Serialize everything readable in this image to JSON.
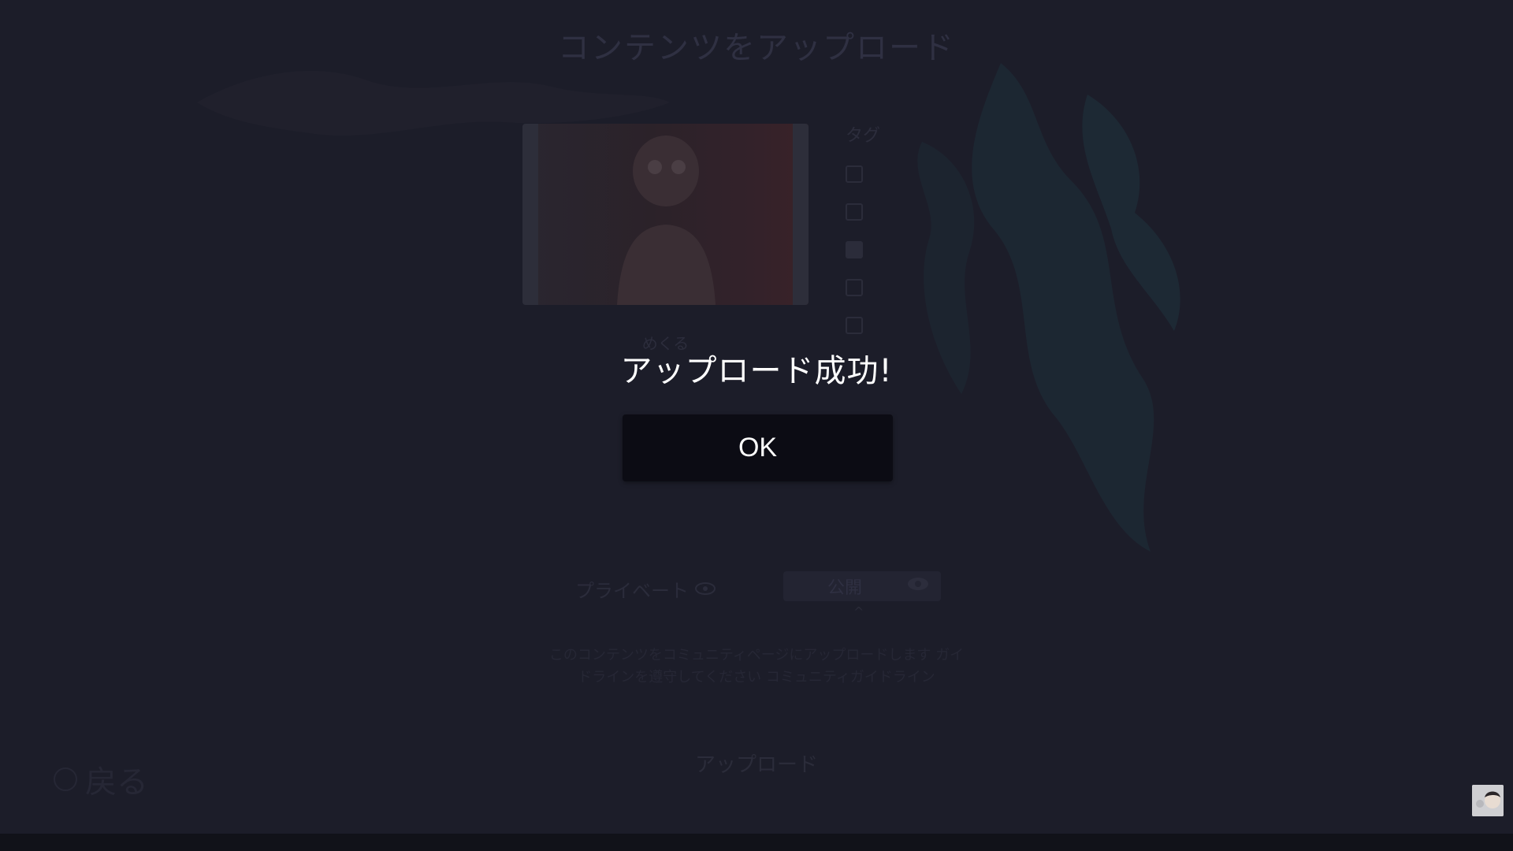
{
  "background": {
    "title": "コンテンツをアップロード",
    "thumbnail_caption": "めくる",
    "tags": {
      "title": "タグ"
    },
    "small_label": "",
    "privacy": {
      "label": "プライベート",
      "selected": "公開"
    },
    "notice": "このコンテンツをコミュニティページにアップロードします ガイドラインを遵守してください コミュニティガイドライン",
    "upload_button": "アップロード",
    "back_label": "戻る"
  },
  "modal": {
    "message": "アップロード成功!",
    "ok_label": "OK"
  },
  "colors": {
    "backdrop": "#1c1d29",
    "modal_text": "#ffffff",
    "ok_button_bg": "#0c0c14"
  }
}
